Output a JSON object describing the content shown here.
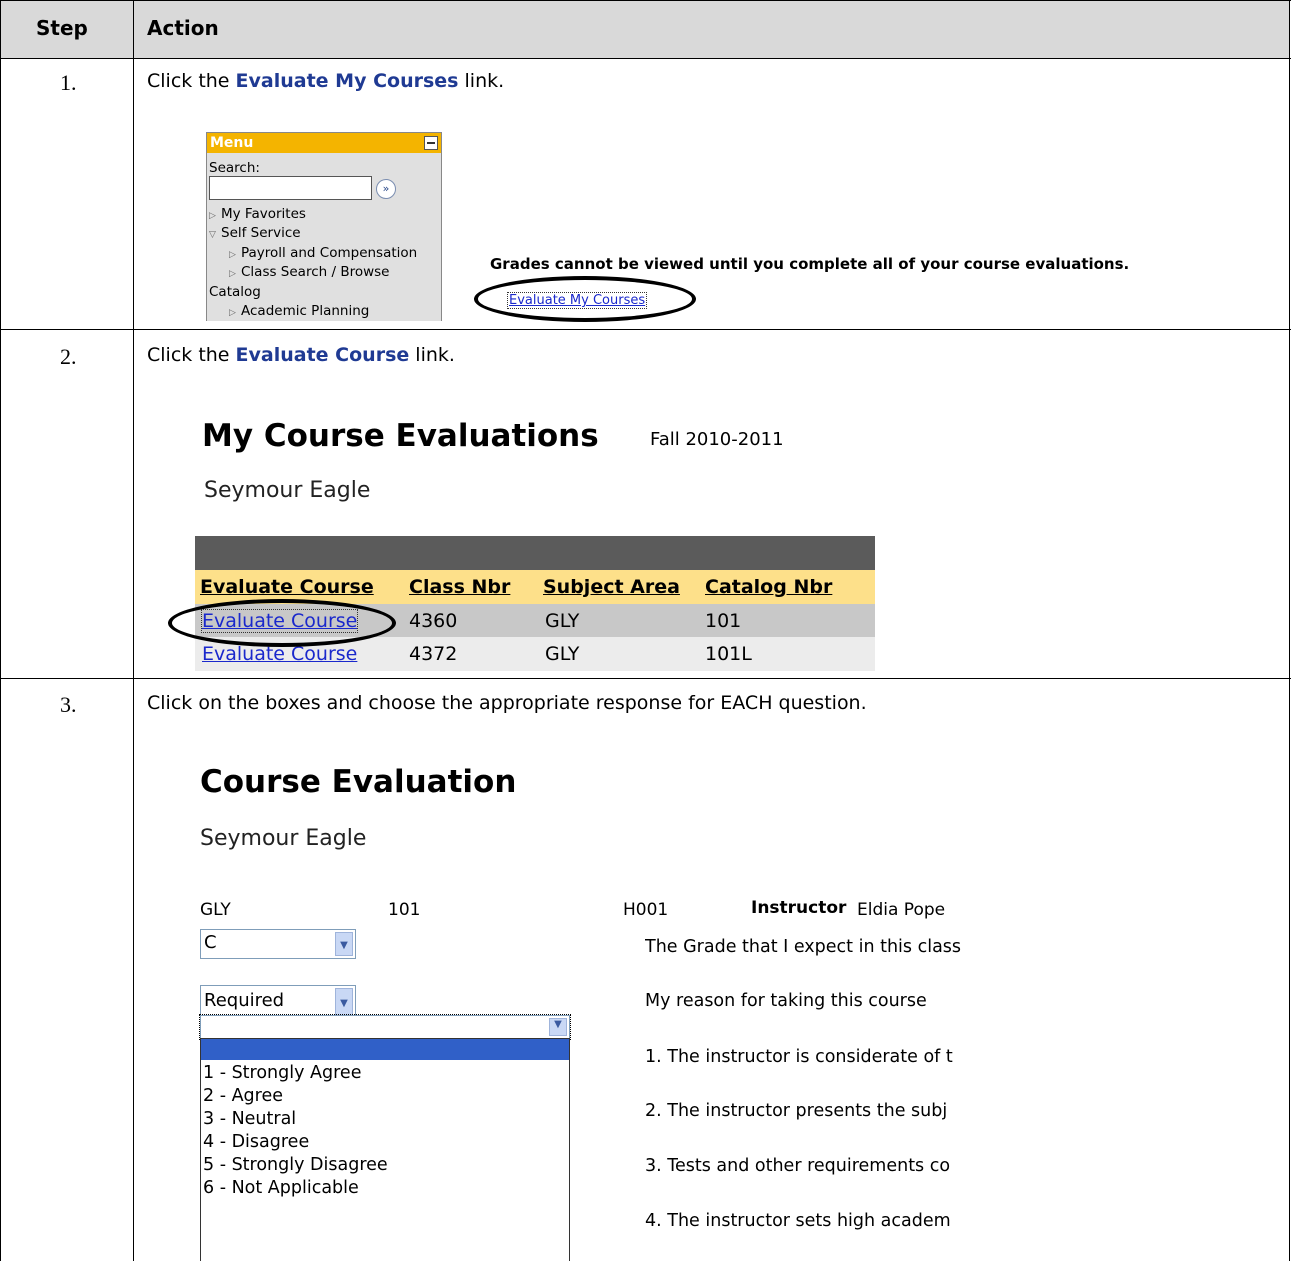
{
  "header": {
    "step_label": "Step",
    "action_label": "Action"
  },
  "steps": [
    {
      "number": "1.",
      "pre": "Click the ",
      "link": "Evaluate My Courses",
      "post": " link."
    },
    {
      "number": "2.",
      "pre": "Click the ",
      "link": "Evaluate Course",
      "post": " link."
    },
    {
      "number": "3.",
      "text": "Click on the boxes and choose the appropriate response for EACH question."
    }
  ],
  "menu": {
    "title": "Menu",
    "search_label": "Search:",
    "go_icon": "»",
    "items": [
      "My Favorites",
      "Self Service",
      "Payroll and Compensation",
      "Class Search / Browse",
      "Catalog",
      "Academic Planning"
    ]
  },
  "grades_message": "Grades cannot be viewed until you complete all of your course evaluations.",
  "evaluate_my_courses_link": "Evaluate My Courses",
  "my_course_evaluations": {
    "title": "My Course Evaluations",
    "term": "Fall 2010-2011",
    "student": "Seymour Eagle",
    "columns": [
      "Evaluate Course",
      "Class Nbr",
      "Subject Area",
      "Catalog Nbr"
    ],
    "rows": [
      [
        "Evaluate Course",
        "4360",
        "GLY",
        "101"
      ],
      [
        "Evaluate Course",
        "4372",
        "GLY",
        "101L"
      ]
    ]
  },
  "course_evaluation": {
    "title": "Course Evaluation",
    "student": "Seymour Eagle",
    "subject": "GLY",
    "catalog": "101",
    "section": "H001",
    "instructor_label": "Instructor",
    "instructor_name": "Eldia Pope",
    "grade_select": "C",
    "reason_select": "Required",
    "grade_question": "The Grade that I expect in this class",
    "reason_question": "My reason for taking this course",
    "questions": [
      "1. The instructor is considerate of t",
      "2. The instructor presents the subj",
      "3. Tests and other requirements co",
      "4. The instructor sets high academ"
    ],
    "options": [
      "1 - Strongly Agree",
      "2 - Agree",
      "3 - Neutral",
      "4 - Disagree",
      "5 - Strongly Disagree",
      "6 - Not Applicable"
    ]
  }
}
